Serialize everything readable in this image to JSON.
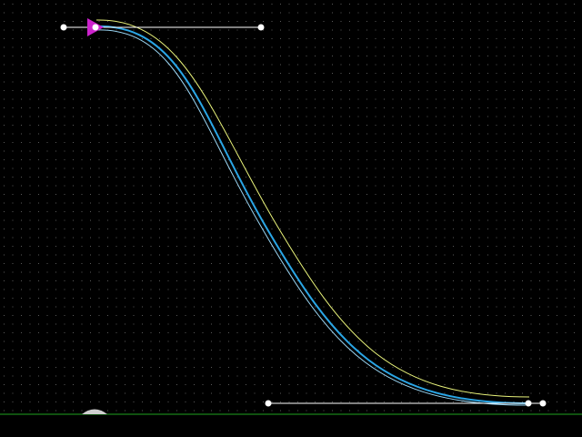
{
  "editor": {
    "background_color": "#000000",
    "grid": {
      "visible": true,
      "dot_color": "#5a5a5a"
    },
    "baseline": {
      "visible": true,
      "color": "#1fa31f"
    },
    "curves": [
      {
        "name": "outer-curve",
        "color": "#e8f27a"
      },
      {
        "name": "middle-curve",
        "color": "#2aa6e6"
      },
      {
        "name": "inner-curve",
        "color": "#9ad6f4"
      }
    ],
    "handles": {
      "line_color": "#ffffff",
      "point_color": "#ffffff",
      "count": 2
    },
    "start_marker": {
      "color": "#cc22cc",
      "icon": "start-arrow-icon"
    },
    "origin_marker": {
      "color": "#cfcfcf",
      "icon": "origin-mound-icon"
    }
  }
}
